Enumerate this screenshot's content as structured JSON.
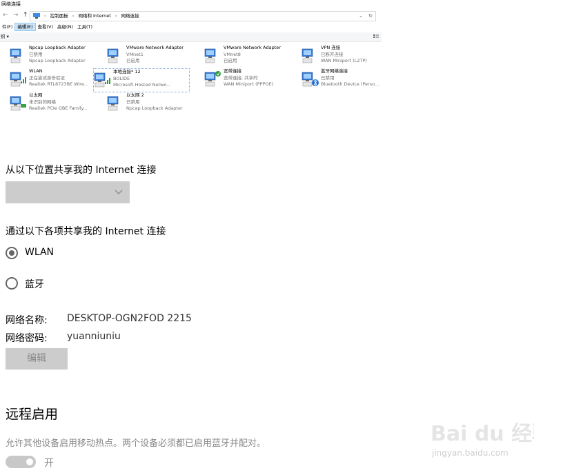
{
  "explorer": {
    "title": "网络连接",
    "nav": {
      "back": "←",
      "forward": "→",
      "up": "↑"
    },
    "breadcrumbs": [
      "控制面板",
      "网络和 Internet",
      "网络连接"
    ],
    "address_tools": {
      "dropdown": "⌄",
      "refresh": "↻"
    },
    "menu": [
      "件(F)",
      "编辑(E)",
      "查看(V)",
      "高级(N)",
      "工具(T)"
    ],
    "menu_active_index": 1,
    "toolbar": {
      "organize": "织 ▾"
    },
    "connections": [
      {
        "name": "Npcap Loopback Adapter",
        "status": "已禁用",
        "device": "Npcap Loopback Adapter",
        "icon": "network-adapter-icon"
      },
      {
        "name": "VMware Network Adapter",
        "status": "VMnet1",
        "device": "已启用",
        "icon": "network-adapter-icon"
      },
      {
        "name": "VMware Network Adapter",
        "status": "VMnet8",
        "device": "已启用",
        "icon": "network-adapter-icon"
      },
      {
        "name": "VPN 连接",
        "status": "已断开连接",
        "device": "WAN Miniport (L2TP)",
        "icon": "vpn-icon"
      },
      {
        "name": "WLAN",
        "status": "正在尝试身份验证",
        "device": "Realtek RTL8723BE Wire...",
        "icon": "wifi-adapter-icon"
      },
      {
        "name": "本地连接* 12",
        "status": "BOLIDE",
        "device": "Microsoft Hosted Netwo...",
        "icon": "wifi-adapter-icon"
      },
      {
        "name": "宽带连接",
        "status": "宽带连接, 共享的",
        "device": "WAN Miniport (PPPOE)",
        "icon": "broadband-icon"
      },
      {
        "name": "蓝牙网络连接",
        "status": "已禁用",
        "device": "Bluetooth Device (Perso...",
        "icon": "bluetooth-adapter-icon"
      },
      {
        "name": "以太网",
        "status": "未识别的网络",
        "device": "Realtek PCIe GBE Family...",
        "icon": "ethernet-adapter-icon"
      },
      {
        "name": "以太网 2",
        "status": "已禁用",
        "device": "Npcap Loopback Adapter",
        "icon": "network-adapter-icon"
      }
    ]
  },
  "settings": {
    "share_from_label": "从以下位置共享我的 Internet 连接",
    "share_from_value": "",
    "share_over_label": "通过以下各项共享我的 Internet 连接",
    "radio_options": [
      {
        "label": "WLAN",
        "selected": true
      },
      {
        "label": "蓝牙",
        "selected": false
      }
    ],
    "network_name_label": "网络名称:",
    "network_name_value": "DESKTOP-OGN2FOD 2215",
    "network_password_label": "网络密码:",
    "network_password_value": "yuanniuniu",
    "edit_button": "编辑",
    "remote_heading": "远程启用",
    "remote_desc": "允许其他设备启用移动热点。两个设备必须都已启用蓝牙并配对。",
    "toggle_state_label": "开",
    "toggle_on": true
  },
  "watermark": {
    "logo": "Bai du 经验",
    "url": "jingyan.baidu.com"
  }
}
